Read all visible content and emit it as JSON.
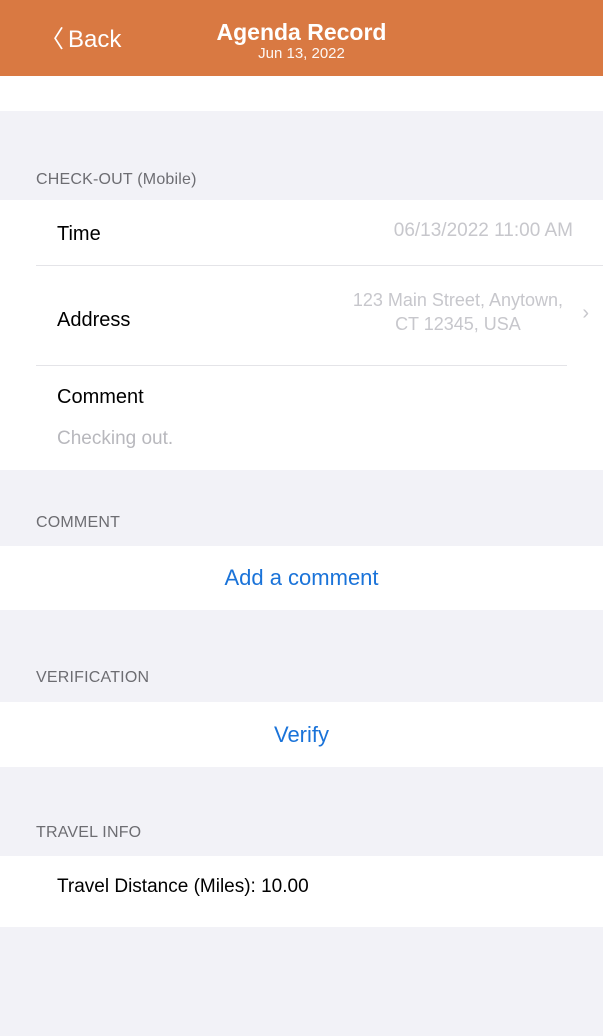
{
  "nav": {
    "back_label": "Back",
    "title": "Agenda Record",
    "subtitle": "Jun 13, 2022"
  },
  "checkout": {
    "header": "CHECK-OUT (Mobile)",
    "time_label": "Time",
    "time_value": "06/13/2022 11:00 AM",
    "address_label": "Address",
    "address_line1": "123 Main Street, Anytown,",
    "address_line2": "CT 12345, USA",
    "comment_label": "Comment",
    "comment_value": "Checking out."
  },
  "comment_section": {
    "header": "COMMENT",
    "action": "Add a comment"
  },
  "verification": {
    "header": "VERIFICATION",
    "action": "Verify"
  },
  "travel": {
    "header": "TRAVEL INFO",
    "distance_text": "Travel Distance (Miles): 10.00"
  },
  "colors": {
    "nav_bg": "#d97942",
    "link": "#1a73d9"
  }
}
